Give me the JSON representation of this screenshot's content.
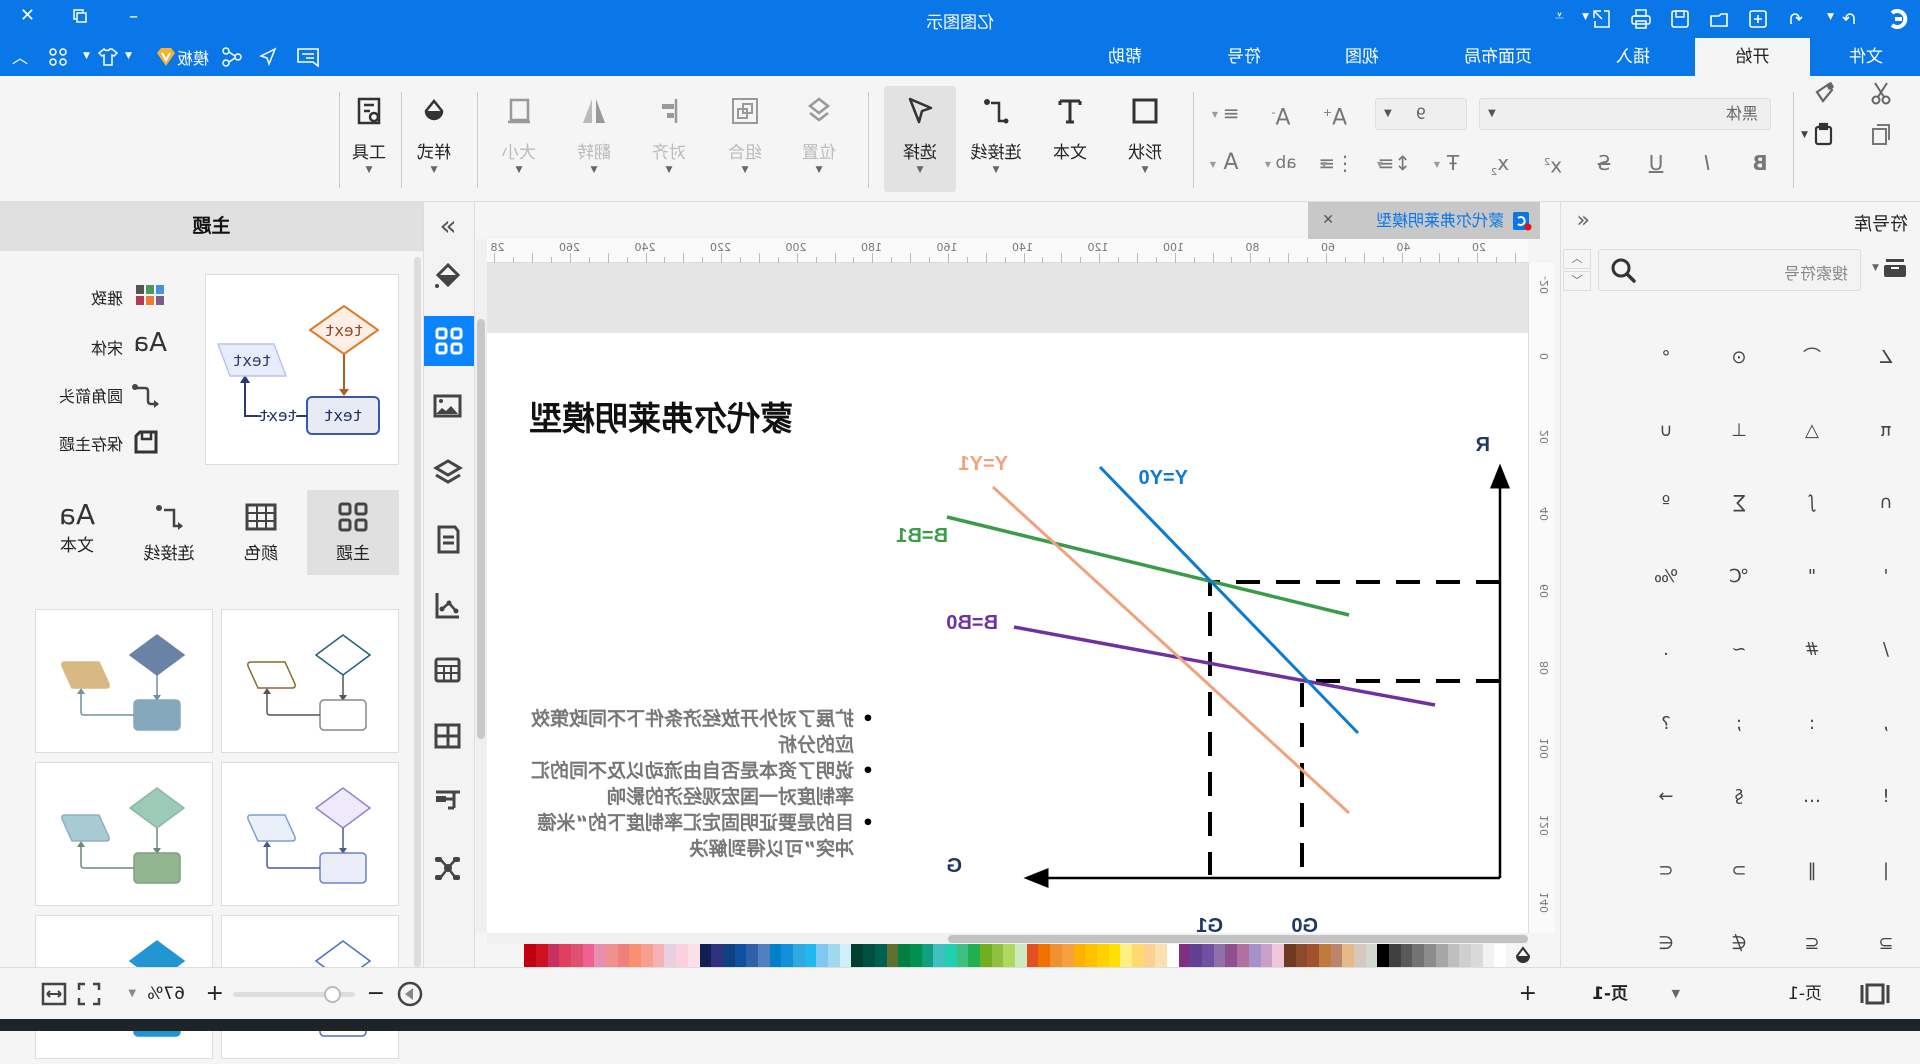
{
  "titlebar": {
    "title": "亿图图示",
    "quick_access": [
      "logo-icon",
      "redo-icon",
      "undo-icon",
      "new-icon",
      "open-icon",
      "save-icon",
      "print-icon",
      "export-icon",
      "more-icon"
    ]
  },
  "menu": {
    "tabs": [
      "文件",
      "开始",
      "插入",
      "页面布局",
      "视图",
      "符号",
      "帮助"
    ],
    "active": "开始",
    "template_label": "模板"
  },
  "ribbon": {
    "font_family": "黑体",
    "font_size": "9",
    "large_buttons": [
      {
        "label": "形状",
        "icon": "rectangle-icon",
        "disabled": false
      },
      {
        "label": "文本",
        "icon": "text-icon",
        "disabled": false
      },
      {
        "label": "连接线",
        "icon": "connector-icon",
        "disabled": false
      },
      {
        "label": "选择",
        "icon": "select-pointer-icon",
        "disabled": false,
        "active": true
      },
      {
        "label": "位置",
        "icon": "position-icon",
        "disabled": true
      },
      {
        "label": "组合",
        "icon": "group-icon",
        "disabled": true
      },
      {
        "label": "对齐",
        "icon": "align-icon",
        "disabled": true
      },
      {
        "label": "翻转",
        "icon": "flip-icon",
        "disabled": true
      },
      {
        "label": "大小",
        "icon": "size-icon",
        "disabled": true
      },
      {
        "label": "样式",
        "icon": "style-icon",
        "disabled": false
      },
      {
        "label": "工具",
        "icon": "tools-icon",
        "disabled": false
      }
    ]
  },
  "symbol_library": {
    "title": "符号库",
    "search_placeholder": "搜索符号",
    "symbols": [
      "∠",
      "⌒",
      "⊙",
      "°",
      "π",
      "△",
      "⊥",
      "∪",
      "∩",
      "∫",
      "∑",
      "º",
      "'",
      "\"",
      "℃",
      "‰",
      "/",
      "#",
      "~",
      ".",
      ",",
      ":",
      ";",
      "?",
      "!",
      "…",
      "§",
      "→",
      "|",
      "‖",
      "⊃",
      "⊂",
      "⊇",
      "⊆",
      "∉",
      "∈"
    ]
  },
  "document": {
    "tab_title": "蒙代尔弗莱明模型",
    "hruler": [
      "20",
      "40",
      "60",
      "80",
      "100",
      "120",
      "140",
      "160",
      "180",
      "200",
      "220",
      "240",
      "260",
      "28"
    ],
    "vruler": [
      "-20",
      "0",
      "20",
      "40",
      "60",
      "80",
      "100",
      "120",
      "140"
    ],
    "title": "蒙代尔弗莱明模型",
    "bullets": [
      [
        "扩展了对外开放经济条件下不同政策效",
        "应的分析"
      ],
      [
        "说明了资本是否自由流动以及不同的汇",
        "率制度对一国宏观经济的影响"
      ],
      [
        "目的是要证明固定汇率制度下的“米德",
        "冲突”可以得到解决"
      ]
    ],
    "diagram": {
      "y_axis": "R",
      "x_axis": "G",
      "G1": "G1",
      "G0": "G0",
      "Y1": "Y=Y1",
      "Y0": "Y=Y0",
      "B1": "B=B1",
      "B0": "B=B0",
      "colors": {
        "Y0": "#0a7bd2",
        "Y1": "#f0a27c",
        "B1": "#3a9b48",
        "B0": "#7030a0",
        "axis_labels": "#1f3864"
      }
    }
  },
  "palette": [
    "#ffffff",
    "#f2f2f2",
    "#d9d9d9",
    "#cfcfcf",
    "#bfbfbf",
    "#a6a6a6",
    "#8c8c8c",
    "#737373",
    "#595959",
    "#404040",
    "#000000",
    "#d0d8d0",
    "#d6c8be",
    "#e6b88a",
    "#b9856b",
    "#c07a3a",
    "#a0522d",
    "#8b4a2b",
    "#6e3b21",
    "#f0c6d8",
    "#c8a0c8",
    "#a890c8",
    "#b070a0",
    "#905090",
    "#9070a8",
    "#7050a0",
    "#604090",
    "#803080",
    "#ffffff",
    "#fde0b0",
    "#fcd090",
    "#ffd870",
    "#fff080",
    "#ffe000",
    "#ffd000",
    "#ffc000",
    "#ffb000",
    "#f8a040",
    "#f09030",
    "#f07000",
    "#e05020",
    "#d0e8c0",
    "#b0d860",
    "#90c040",
    "#70b020",
    "#20b050",
    "#40c080",
    "#20d0b0",
    "#40c0c0",
    "#10a080",
    "#009050",
    "#008040",
    "#607030",
    "#006050",
    "#005040",
    "#004030",
    "#d0f0f8",
    "#a0d8f0",
    "#80c8f0",
    "#20b8f0",
    "#30a8e0",
    "#1090d8",
    "#0080c8",
    "#5080c0",
    "#3060a8",
    "#1050a0",
    "#104080",
    "#303080",
    "#102050",
    "#fce0e8",
    "#fcd0e0",
    "#e8d0e0",
    "#f8b0b0",
    "#f8a090",
    "#f89070",
    "#f08080",
    "#f09090",
    "#e890b0",
    "#f06090",
    "#e05070",
    "#e04060",
    "#c83060",
    "#d01020",
    "#c00010"
  ],
  "theme_panel": {
    "title": "主题",
    "options": [
      {
        "label": "雅致",
        "icon": "color-grid-icon"
      },
      {
        "label": "宋体",
        "icon": "font-aa-icon"
      },
      {
        "label": "圆角箭头",
        "icon": "rounded-arrow-icon"
      },
      {
        "label": "保存主题",
        "icon": "save-theme-icon"
      }
    ],
    "preview_text": "text",
    "tabs": [
      {
        "label": "主题",
        "icon": "theme-grid-icon"
      },
      {
        "label": "颜色",
        "icon": "color-table-icon"
      },
      {
        "label": "连接线",
        "icon": "connector-icon"
      },
      {
        "label": "文本",
        "icon": "font-aa-icon"
      }
    ],
    "active_tab": "主题",
    "cards": [
      {
        "diamond": "#ffffff",
        "diamond_stroke": "#1f5f7a",
        "rect": "#ffffff",
        "rect_stroke": "#888888",
        "para": "#ffffff",
        "para_stroke": "#8a6a30",
        "line": "#555555"
      },
      {
        "diamond": "#6a82a6",
        "diamond_stroke": "#6a82a6",
        "rect": "#85a8bd",
        "rect_stroke": "#85a8bd",
        "para": "#d8b984",
        "para_stroke": "#d8b984",
        "line": "#7090a0"
      },
      {
        "diamond": "#efeafb",
        "diamond_stroke": "#9080d0",
        "rect": "#ebeef8",
        "rect_stroke": "#6a80c8",
        "para": "#eaf0fa",
        "para_stroke": "#7aa0d0",
        "line": "#4a5a90"
      },
      {
        "diamond": "#9ccab6",
        "diamond_stroke": "#8ab8a4",
        "rect": "#93b590",
        "rect_stroke": "#80a080",
        "para": "#a8cad2",
        "para_stroke": "#90b0c0",
        "line": "#6a8a70"
      },
      {
        "diamond": "#ffffff",
        "diamond_stroke": "#4a70b8",
        "rect": "#ffffff",
        "rect_stroke": "#4a70b8",
        "para": "#e8b0c0",
        "para_stroke": "#d090a0",
        "line": "#4a70b8"
      },
      {
        "diamond": "#2196d3",
        "diamond_stroke": "#2196d3",
        "rect": "#2196d3",
        "rect_stroke": "#2196d3",
        "para": "#f0a020",
        "para_stroke": "#f0a020",
        "line": "#2196d3"
      }
    ]
  },
  "statusbar": {
    "page_tab": "页-1",
    "current_page": "页-1",
    "zoom": "67%",
    "zoom_level_percent": 67
  }
}
